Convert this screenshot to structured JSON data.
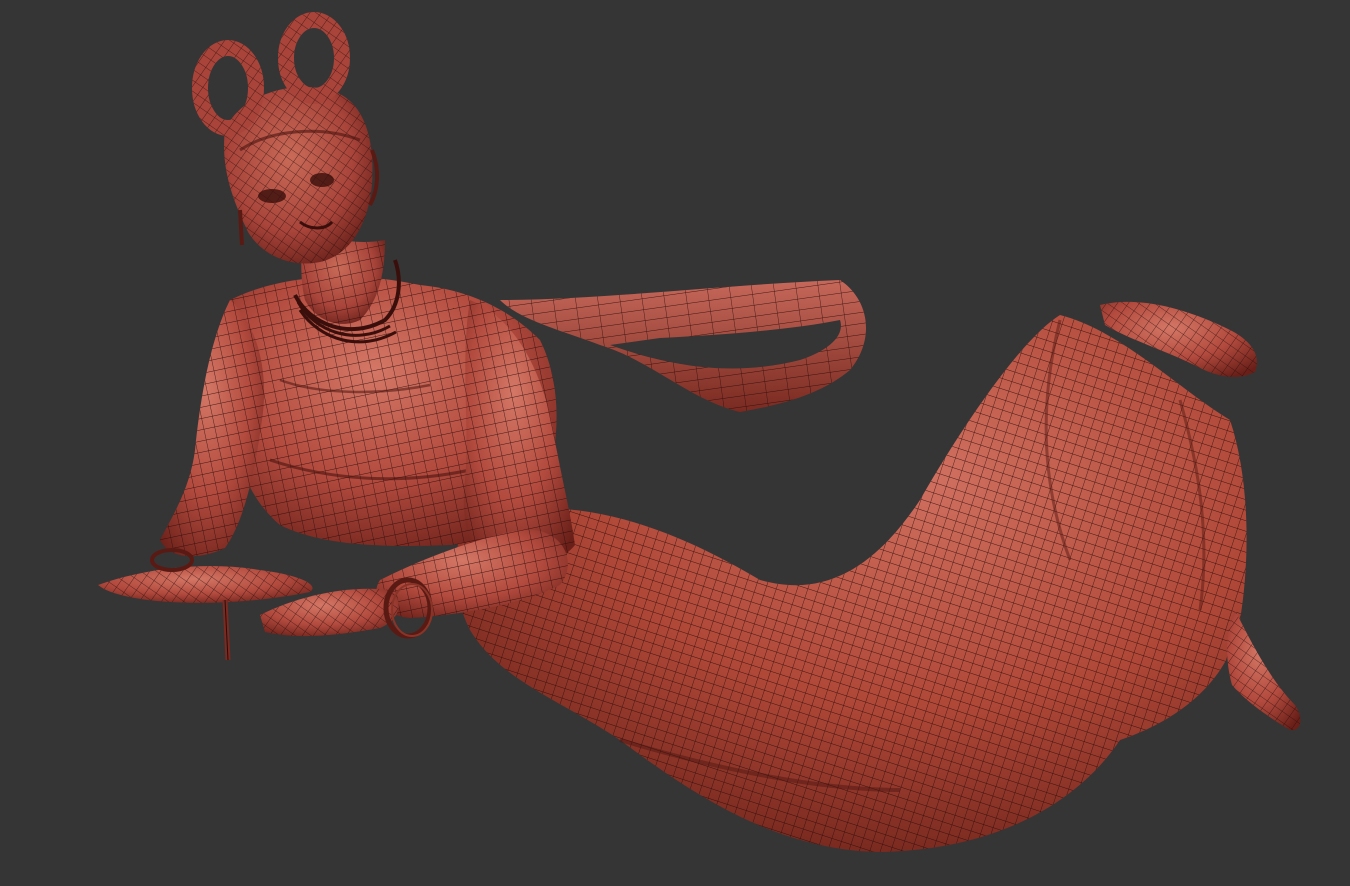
{
  "viewport": {
    "background": "#353535",
    "model": {
      "material_base": "#b24a3e",
      "material_dark": "#5a1a14",
      "material_light": "#d0705f",
      "wire_color": "#2a0c09",
      "display_mode": "polyframe-wireframe"
    }
  }
}
